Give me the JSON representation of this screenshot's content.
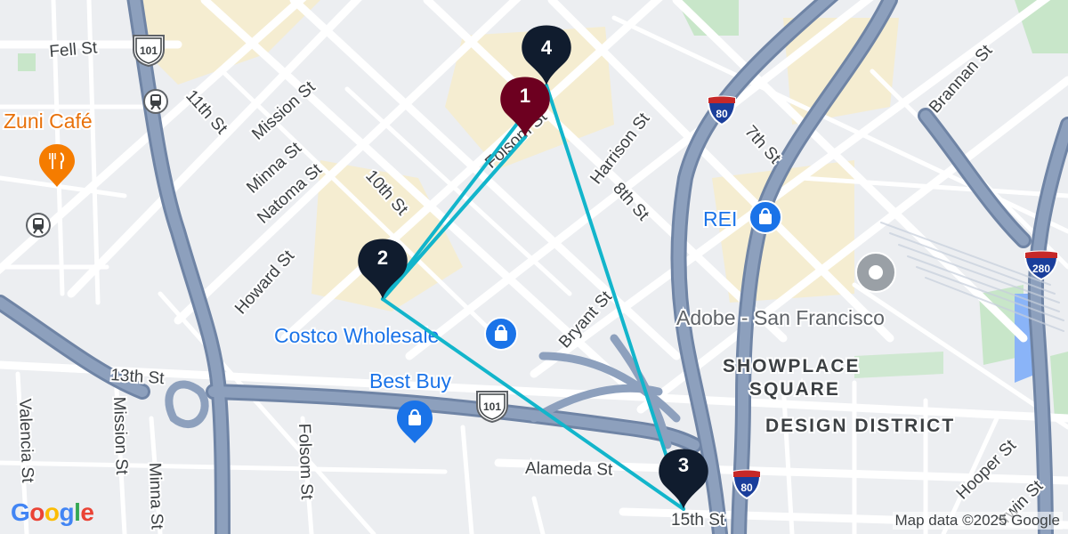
{
  "map": {
    "colors": {
      "background": "#eceef1",
      "street": "#ffffff",
      "freeway": "#8da0bd",
      "freeway_edge": "#6f84a5",
      "commercial": "#f7eccb",
      "park": "#c8e6c9",
      "water": "#8ab4f8",
      "route": "#12b5cb",
      "pin_dark": "#101c2e",
      "pin_active": "#6d0020",
      "poi_blue": "#1a73e8",
      "poi_orange": "#f57c00",
      "poi_gray": "#9aa0a6"
    },
    "street_labels": [
      {
        "id": "fell-st",
        "text": "Fell St"
      },
      {
        "id": "mission-st-north",
        "text": "Mission St"
      },
      {
        "id": "11th-st",
        "text": "11th St"
      },
      {
        "id": "minna-st-north",
        "text": "Minna St"
      },
      {
        "id": "natoma-st",
        "text": "Natoma St"
      },
      {
        "id": "10th-st",
        "text": "10th St"
      },
      {
        "id": "howard-st",
        "text": "Howard St"
      },
      {
        "id": "folsom-st-north",
        "text": "Folsom St"
      },
      {
        "id": "harrison-st",
        "text": "Harrison St"
      },
      {
        "id": "8th-st",
        "text": "8th St"
      },
      {
        "id": "7th-st",
        "text": "7th St"
      },
      {
        "id": "brannan-st",
        "text": "Brannan St"
      },
      {
        "id": "bryant-st",
        "text": "Bryant St"
      },
      {
        "id": "13th-st",
        "text": "13th St"
      },
      {
        "id": "valencia-st",
        "text": "Valencia St"
      },
      {
        "id": "mission-st-south",
        "text": "Mission St"
      },
      {
        "id": "minna-st-south",
        "text": "Minna St"
      },
      {
        "id": "folsom-st-south",
        "text": "Folsom St"
      },
      {
        "id": "alameda-st",
        "text": "Alameda St"
      },
      {
        "id": "15th-st",
        "text": "15th St"
      },
      {
        "id": "hooper-st",
        "text": "Hooper St"
      },
      {
        "id": "irwin-st",
        "text": "Irwin St"
      }
    ],
    "district_labels": [
      {
        "id": "showplace-square-1",
        "text": "SHOWPLACE"
      },
      {
        "id": "showplace-square-2",
        "text": "SQUARE"
      },
      {
        "id": "design-district",
        "text": "DESIGN DISTRICT"
      }
    ],
    "highway_shields": [
      {
        "id": "us-101-north",
        "text": "101",
        "type": "us-highway"
      },
      {
        "id": "us-101-south",
        "text": "101",
        "type": "us-highway"
      },
      {
        "id": "i-80-north",
        "text": "80",
        "type": "interstate"
      },
      {
        "id": "i-80-south",
        "text": "80",
        "type": "interstate"
      },
      {
        "id": "i-280",
        "text": "280",
        "type": "interstate"
      }
    ],
    "pois": [
      {
        "id": "zuni-cafe",
        "label": "Zuni Café",
        "icon": "restaurant-icon",
        "color": "#f57c00"
      },
      {
        "id": "rei",
        "label": "REI",
        "icon": "shopping-bag-icon",
        "color": "#1a73e8"
      },
      {
        "id": "costco",
        "label": "Costco Wholesale",
        "icon": "shopping-bag-icon",
        "color": "#1a73e8"
      },
      {
        "id": "best-buy",
        "label": "Best Buy",
        "icon": "shopping-bag-icon",
        "color": "#1a73e8"
      },
      {
        "id": "adobe",
        "label": "Adobe - San Francisco",
        "icon": "place-dot-icon",
        "color": "#9aa0a6"
      }
    ],
    "transit_stations": [
      {
        "id": "transit-1",
        "icon": "tram-icon"
      },
      {
        "id": "transit-2",
        "icon": "tram-icon"
      }
    ],
    "markers": [
      {
        "id": "marker-1",
        "label": "1",
        "color": "#6d0020",
        "selected": true
      },
      {
        "id": "marker-2",
        "label": "2",
        "color": "#101c2e",
        "selected": false
      },
      {
        "id": "marker-3",
        "label": "3",
        "color": "#101c2e",
        "selected": false
      },
      {
        "id": "marker-4",
        "label": "4",
        "color": "#101c2e",
        "selected": false
      }
    ],
    "route": {
      "order": [
        "1",
        "2",
        "3",
        "4",
        "1"
      ],
      "color": "#12b5cb"
    },
    "branding": {
      "logo_letters": [
        {
          "char": "G",
          "color": "#4285f4"
        },
        {
          "char": "o",
          "color": "#ea4335"
        },
        {
          "char": "o",
          "color": "#fbbc05"
        },
        {
          "char": "g",
          "color": "#4285f4"
        },
        {
          "char": "l",
          "color": "#34a853"
        },
        {
          "char": "e",
          "color": "#ea4335"
        }
      ],
      "attribution": "Map data ©2025 Google"
    }
  }
}
